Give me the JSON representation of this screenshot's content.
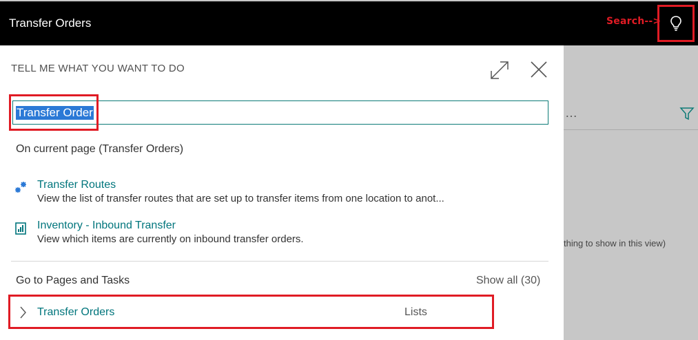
{
  "app": {
    "title": "Transfer Orders"
  },
  "annotation": {
    "search_hint": "Search-->"
  },
  "background": {
    "empty_text": "thing to show in this view)"
  },
  "tellme": {
    "header": "TELL ME WHAT YOU WANT TO DO",
    "search_value": "Transfer Order",
    "current_page_heading": "On current page (Transfer Orders)",
    "results": [
      {
        "title": "Transfer Routes",
        "description": "View the list of transfer routes that are set up to transfer items from one location to anot...",
        "icon": "routes-icon"
      },
      {
        "title": "Inventory - Inbound Transfer",
        "description": "View which items are currently on inbound transfer orders.",
        "icon": "report-icon"
      }
    ],
    "pages_heading": "Go to Pages and Tasks",
    "show_all": "Show all (30)",
    "tasks": [
      {
        "label": "Transfer Orders",
        "category": "Lists"
      }
    ]
  },
  "colors": {
    "accent": "#00757c",
    "highlight": "#e01b24",
    "selection": "#2b79d6"
  }
}
